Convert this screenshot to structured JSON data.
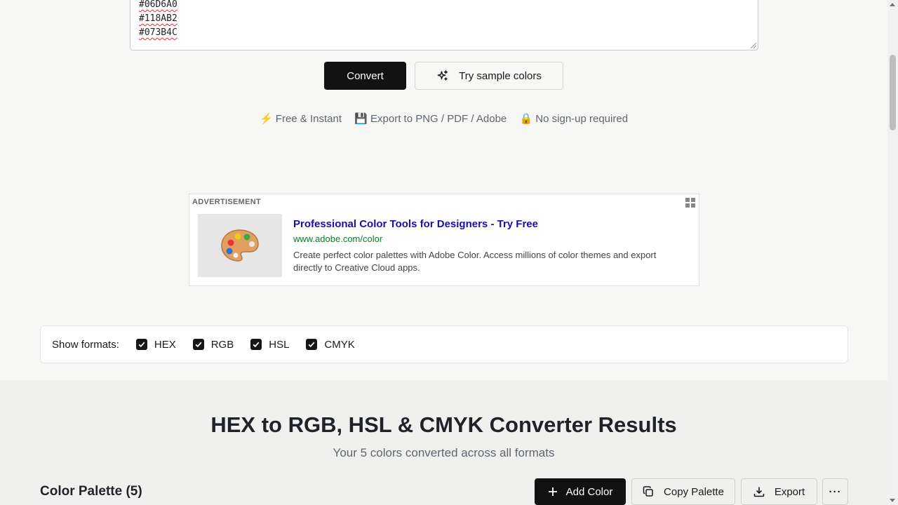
{
  "input": {
    "lines": [
      "#06D6A0",
      "#118AB2",
      "#073B4C"
    ]
  },
  "actions": {
    "convert_label": "Convert",
    "sample_label": "Try sample colors"
  },
  "features": [
    "⚡ Free & Instant",
    "💾 Export to PNG / PDF / Adobe",
    "🔒 No sign-up required"
  ],
  "ad": {
    "label": "ADVERTISEMENT",
    "title": "Professional Color Tools for Designers - Try Free",
    "url": "www.adobe.com/color",
    "description": "Create perfect color palettes with Adobe Color. Access millions of color themes and export directly to Creative Cloud apps.",
    "thumb_emoji": "🎨"
  },
  "formats": {
    "label": "Show formats:",
    "options": [
      {
        "name": "HEX",
        "checked": true
      },
      {
        "name": "RGB",
        "checked": true
      },
      {
        "name": "HSL",
        "checked": true
      },
      {
        "name": "CMYK",
        "checked": true
      }
    ]
  },
  "results": {
    "title": "HEX to RGB, HSL & CMYK Converter Results",
    "subtitle": "Your 5 colors converted across all formats",
    "palette_title": "Color Palette (5)",
    "add_label": "Add Color",
    "copy_label": "Copy Palette",
    "export_label": "Export",
    "more_label": "···"
  },
  "colors": {
    "primary_button": "#121212",
    "ad_title": "#1a0dab",
    "ad_url": "#0d7a2c"
  }
}
